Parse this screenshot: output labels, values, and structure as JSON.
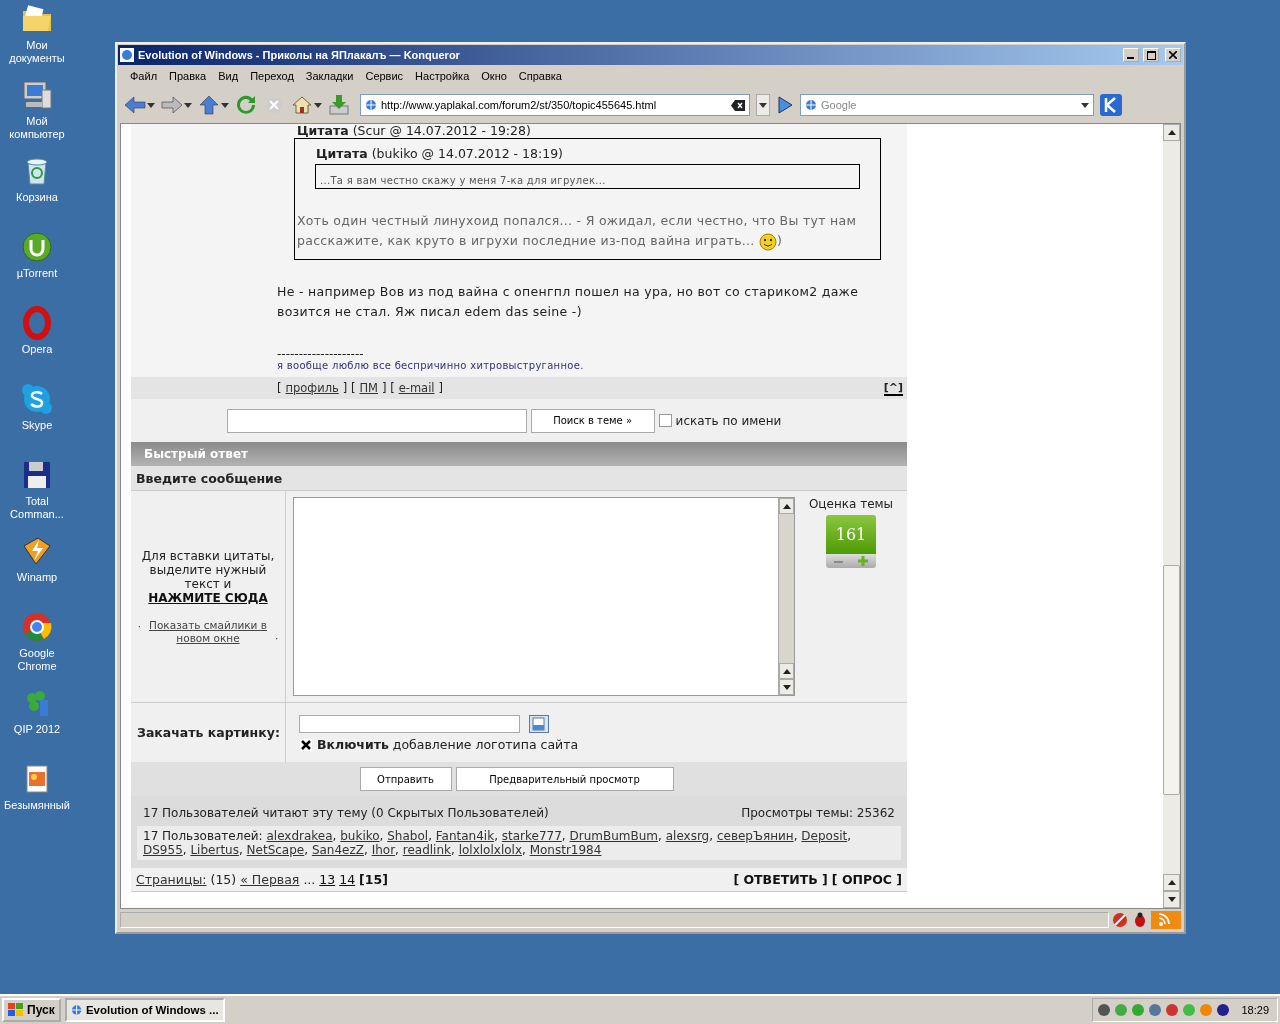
{
  "desktop_icons": [
    {
      "kind": "folder",
      "label": "Мои документы"
    },
    {
      "kind": "computer",
      "label": "Мой компьютер"
    },
    {
      "kind": "recycle",
      "label": "Корзина"
    },
    {
      "kind": "torrent",
      "label": "µTorrent"
    },
    {
      "kind": "opera",
      "label": "Opera"
    },
    {
      "kind": "skype",
      "label": "Skype"
    },
    {
      "kind": "floppy",
      "label": "Total Comman..."
    },
    {
      "kind": "winamp",
      "label": "Winamp"
    },
    {
      "kind": "chrome",
      "label": "Google Chrome"
    },
    {
      "kind": "qip",
      "label": "QIP 2012"
    },
    {
      "kind": "image",
      "label": "Безымянный"
    }
  ],
  "window": {
    "title": "Evolution of Windows - Приколы на ЯПлакалъ — Konqueror",
    "menu": [
      "Файл",
      "Правка",
      "Вид",
      "Переход",
      "Закладки",
      "Сервис",
      "Настройка",
      "Окно",
      "Справка"
    ],
    "address": "http://www.yaplakal.com/forum2/st/350/topic455645.html",
    "search_placeholder": "Google"
  },
  "post": {
    "outer_quote": {
      "label": "Цитата",
      "meta": "(Scur @ 14.07.2012 - 19:28)",
      "inner_quote": {
        "label": "Цитата",
        "meta": "(bukiko @ 14.07.2012 - 18:19)",
        "text": "...Та я вам честно скажу у меня 7-ка для игрулек..."
      },
      "text": "Хоть один честный линухоид попался... - Я ожидал, если честно, что Вы тут нам расскажите, как круто в игрухи последние из-под вайна играть...",
      "text_after": ")"
    },
    "body": "Не - например Вов из под вайна с опенгпл пошел на ура, но вот со стариком2 даже возится не стал. Яж писал edem das seine -)",
    "signature_divider": "--------------------",
    "signature": "я вообще люблю все беспричинно хитровыструганное.",
    "links": [
      {
        "kind": "text",
        "text": "["
      },
      {
        "kind": "link",
        "text": "профиль"
      },
      {
        "kind": "text",
        "text": "] ["
      },
      {
        "kind": "link",
        "text": "ПМ"
      },
      {
        "kind": "text",
        "text": "] ["
      },
      {
        "kind": "link",
        "text": "e-mail"
      },
      {
        "kind": "text",
        "text": "]"
      }
    ],
    "top_link": "[^]"
  },
  "topic_search": {
    "button": "Поиск в теме »",
    "by_name": {
      "label": "искать по имени",
      "checked": false
    }
  },
  "quick_reply": {
    "header": "Быстрый ответ",
    "subheader": "Введите сообщение",
    "hint": "Для вставки цитаты, выделите нужный текст и",
    "hint_link": "НАЖМИТЕ СЮДА",
    "bullet": "·",
    "smilies_link": "Показать смайлики в новом окне",
    "rating_label": "Оценка темы",
    "rating": "161",
    "upload_label": "Закачать картинку:",
    "logo": {
      "label": "**Включить** добавление логотипа сайта",
      "checked": true
    },
    "buttons": [
      "Отправить",
      "Предварительный просмотр"
    ]
  },
  "readers": {
    "summary": "17 Пользователей читают эту тему (0 Скрытых Пользователей)",
    "views": "Просмотры темы: 25362",
    "prefix": "17 Пользователей:",
    "separator": ",",
    "users": [
      "alexdrakea",
      "bukiko",
      "Shabol",
      "Fantan4ik",
      "starke777",
      "DrumBumBum",
      "alexsrg",
      "северЪянин",
      "Deposit",
      "DS955",
      "Libertus",
      "NetScape",
      "San4ezZ",
      "Ihor",
      "readlink",
      "lolxlolxlolx",
      "Monstr1984"
    ]
  },
  "pagination": {
    "label": "Страницы:",
    "count": "(15)",
    "first": "« Первая",
    "ellipsis": "...",
    "pages": [
      {
        "label": "13",
        "selected": false
      },
      {
        "label": "14",
        "selected": false
      },
      {
        "label": "[15]",
        "selected": true
      }
    ],
    "actions": [
      "[ ОТВЕТИТЬ ]",
      "[ ОПРОС ]"
    ]
  },
  "taskbar": {
    "start": "Пуск",
    "task": "Evolution of Windows ...",
    "clock": "18:29"
  }
}
